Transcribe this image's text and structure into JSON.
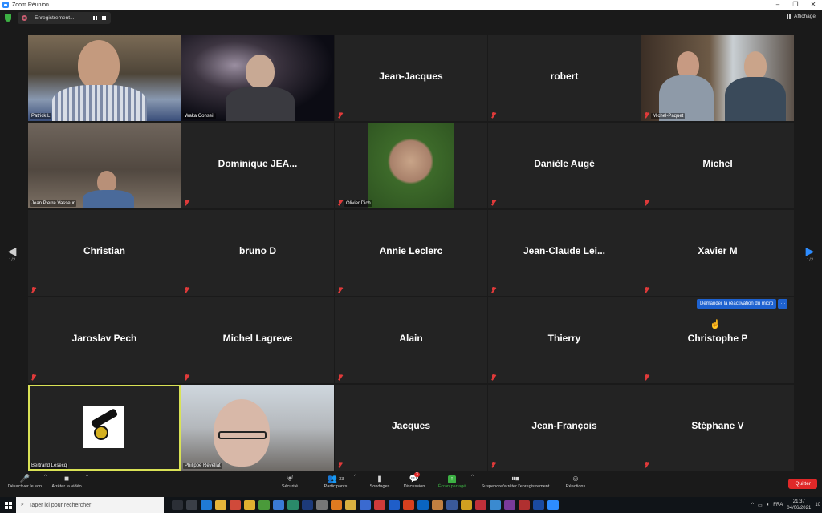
{
  "window": {
    "title": "Zoom Réunion",
    "controls": [
      "–",
      "❐",
      "✕"
    ]
  },
  "topbar": {
    "recording_label": "Enregistrement...",
    "view_label": "Affichage"
  },
  "grid": {
    "tiles": [
      {
        "name": "Patrick L",
        "kind": "video",
        "muted": false
      },
      {
        "name": "Waka Conseil",
        "kind": "video",
        "muted": false
      },
      {
        "name": "Jean-Jacques",
        "kind": "name",
        "muted": true
      },
      {
        "name": "robert",
        "kind": "name",
        "muted": true
      },
      {
        "name": "Michel-Paquet",
        "kind": "video",
        "muted": true
      },
      {
        "name": "Jean Pierre Vasseur",
        "kind": "video",
        "muted": false
      },
      {
        "name": "Dominique  JEA...",
        "kind": "name",
        "muted": true
      },
      {
        "name": "Olivier Dich",
        "kind": "photo",
        "muted": true
      },
      {
        "name": "Danièle Augé",
        "kind": "name",
        "muted": true
      },
      {
        "name": "Michel",
        "kind": "name",
        "muted": true
      },
      {
        "name": "Christian",
        "kind": "name",
        "muted": true
      },
      {
        "name": "bruno D",
        "kind": "name",
        "muted": true
      },
      {
        "name": "Annie Leclerc",
        "kind": "name",
        "muted": true
      },
      {
        "name": "Jean-Claude  Lei...",
        "kind": "name",
        "muted": true
      },
      {
        "name": "Xavier M",
        "kind": "name",
        "muted": true
      },
      {
        "name": "Jaroslav Pech",
        "kind": "name",
        "muted": true
      },
      {
        "name": "Michel Lagreve",
        "kind": "name",
        "muted": true
      },
      {
        "name": "Alain",
        "kind": "name",
        "muted": true
      },
      {
        "name": "Thierry",
        "kind": "name",
        "muted": true
      },
      {
        "name": "Christophe P",
        "kind": "name",
        "muted": true
      },
      {
        "name": "Bertrand Lesecq",
        "kind": "photo",
        "muted": false
      },
      {
        "name": "Philippe Revellat",
        "kind": "video",
        "muted": false
      },
      {
        "name": "Jacques",
        "kind": "name",
        "muted": true
      },
      {
        "name": "Jean-François",
        "kind": "name",
        "muted": true
      },
      {
        "name": "Stéphane V",
        "kind": "name",
        "muted": true
      }
    ],
    "reactivate_label": "Demander la réactivation du micro",
    "reactivate_more": "···",
    "page_left": "1/2",
    "page_right": "1/2"
  },
  "toolbar": {
    "mute_label": "Désactiver le son",
    "video_label": "Arrêter la vidéo",
    "security_label": "Sécurité",
    "participants_label": "Participants",
    "participants_count": "33",
    "polls_label": "Sondages",
    "chat_label": "Discussion",
    "chat_badge": "3",
    "share_label": "Écran partagé",
    "record_label": "Suspendre/arrêter l'enregistrement",
    "reactions_label": "Réactions",
    "quit_label": "Quitter"
  },
  "taskbar": {
    "search_placeholder": "Taper ici pour rechercher",
    "language": "FRA",
    "time": "21:37",
    "date": "04/06/2021",
    "notifications": "10"
  },
  "icons": {
    "accent_blue": "#2d8cff",
    "mute_red": "#e03a3a",
    "share_green": "#3cb043",
    "quit_red": "#e02828"
  }
}
